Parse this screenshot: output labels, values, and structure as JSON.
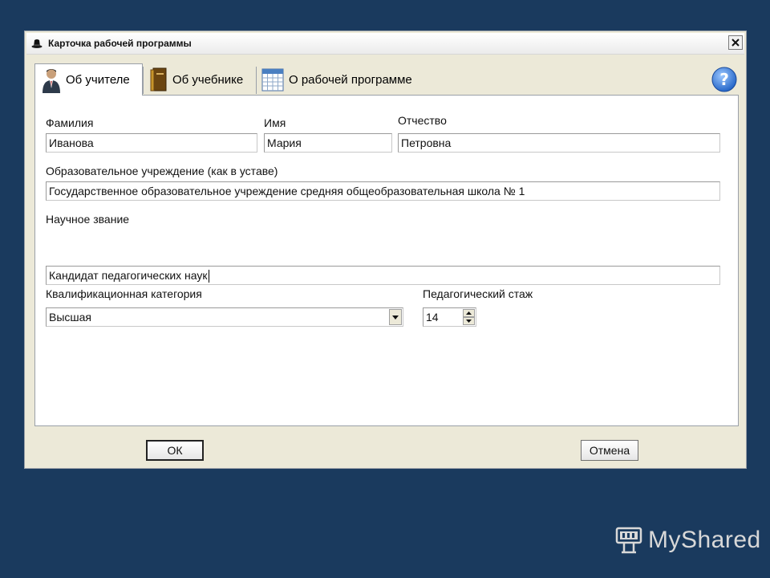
{
  "window": {
    "title": "Карточка рабочей программы",
    "icon": "black-hat-icon",
    "close_icon": "close-icon"
  },
  "tabs": [
    {
      "label": "Об учителе",
      "icon": "teacher-icon",
      "active": true
    },
    {
      "label": "Об учебнике",
      "icon": "book-icon",
      "active": false
    },
    {
      "label": "О рабочей программе",
      "icon": "calendar-icon",
      "active": false
    }
  ],
  "help_icon": "help-icon",
  "form": {
    "surname": {
      "label": "Фамилия",
      "value": "Иванова"
    },
    "name": {
      "label": "Имя",
      "value": "Мария"
    },
    "patronymic": {
      "label": "Отчество",
      "value": "Петровна"
    },
    "institution": {
      "label": "Образовательное учреждение (как в уставе)",
      "value": "Государственное образовательное учреждение средняя общеобразовательная школа № 1"
    },
    "degree": {
      "label": "Научное звание",
      "value": "Кандидат педагогических наук"
    },
    "category": {
      "label": "Квалификационная категория",
      "value": "Высшая"
    },
    "experience": {
      "label": "Педагогический стаж",
      "value": "14"
    }
  },
  "buttons": {
    "ok": "ОК",
    "cancel": "Отмена"
  },
  "brand": {
    "text": "MyShared",
    "icon": "presentation-board-icon"
  },
  "colors": {
    "background": "#1a3a5e",
    "window": "#ece9d8",
    "panel": "#ffffff"
  }
}
